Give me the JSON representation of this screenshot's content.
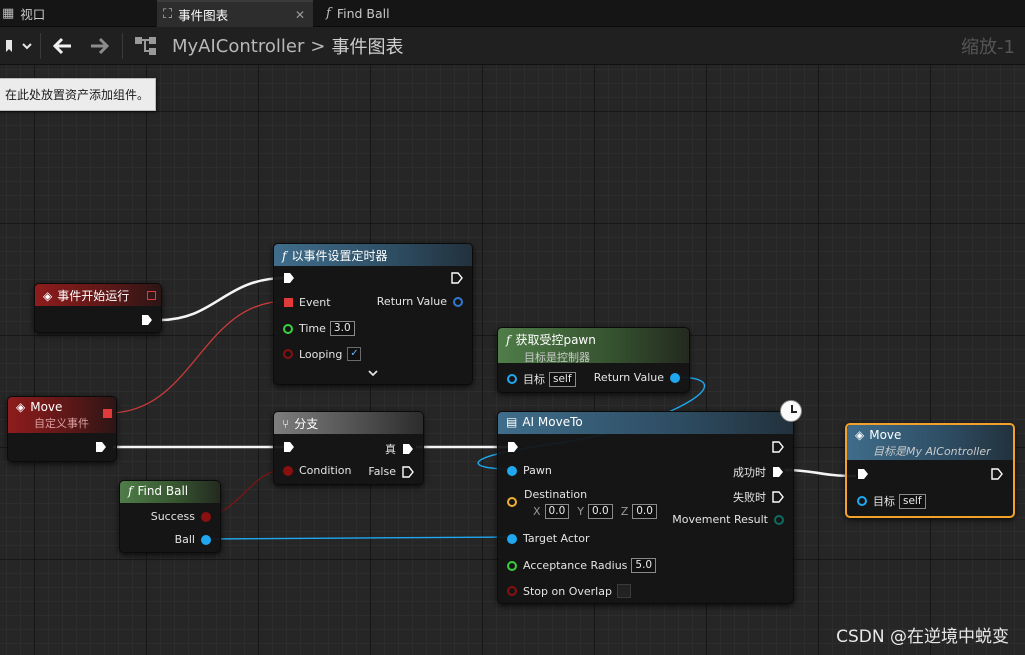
{
  "tabs": [
    {
      "label": "视口",
      "icon": "grid-icon"
    },
    {
      "label": "事件图表",
      "icon": "graph-icon",
      "active": true
    },
    {
      "label": "Find Ball",
      "icon": "function-icon"
    }
  ],
  "toolbar": {
    "breadcrumb_root": "MyAIController",
    "breadcrumb_separator": ">",
    "breadcrumb_current": "事件图表",
    "zoom": "缩放-1"
  },
  "hint_text": "在此处放置资产添加组件。",
  "nodes": {
    "begin_play": {
      "title": "事件开始运行"
    },
    "set_timer": {
      "title": "以事件设置定时器",
      "pin_event": "Event",
      "pin_time": "Time",
      "time_value": "3.0",
      "pin_looping": "Looping",
      "pin_return": "Return Value"
    },
    "get_pawn": {
      "title": "获取受控pawn",
      "subtitle": "目标是控制器",
      "pin_target": "目标",
      "target_value": "self",
      "pin_return": "Return Value"
    },
    "move_event": {
      "title": "Move",
      "subtitle": "自定义事件"
    },
    "branch": {
      "title": "分支",
      "pin_condition": "Condition",
      "pin_true": "真",
      "pin_false": "False"
    },
    "find_ball": {
      "title": "Find Ball",
      "pin_success": "Success",
      "pin_ball": "Ball"
    },
    "ai_moveto": {
      "title": "AI MoveTo",
      "pin_pawn": "Pawn",
      "pin_destination": "Destination",
      "x_label": "X",
      "x_value": "0.0",
      "y_label": "Y",
      "y_value": "0.0",
      "z_label": "Z",
      "z_value": "0.0",
      "pin_target_actor": "Target Actor",
      "pin_acceptance": "Acceptance Radius",
      "acceptance_value": "5.0",
      "pin_stop_overlap": "Stop on Overlap",
      "pin_on_success": "成功时",
      "pin_on_fail": "失败时",
      "pin_movement_result": "Movement Result"
    },
    "move_call": {
      "title": "Move",
      "subtitle": "目标是My AIController",
      "pin_target": "目标",
      "target_value": "self"
    }
  },
  "colors": {
    "exec_wire": "#ffffff",
    "object_pin": "#1fa8f0",
    "bool_pin": "#8a1010",
    "float_pin": "#38d13c",
    "vector_pin": "#f0b030",
    "delegate_pin": "#e03a3a",
    "enum_pin": "#0f6b60",
    "selection_outline": "#f2a12a"
  },
  "watermark": "CSDN @在逆境中蜕变"
}
